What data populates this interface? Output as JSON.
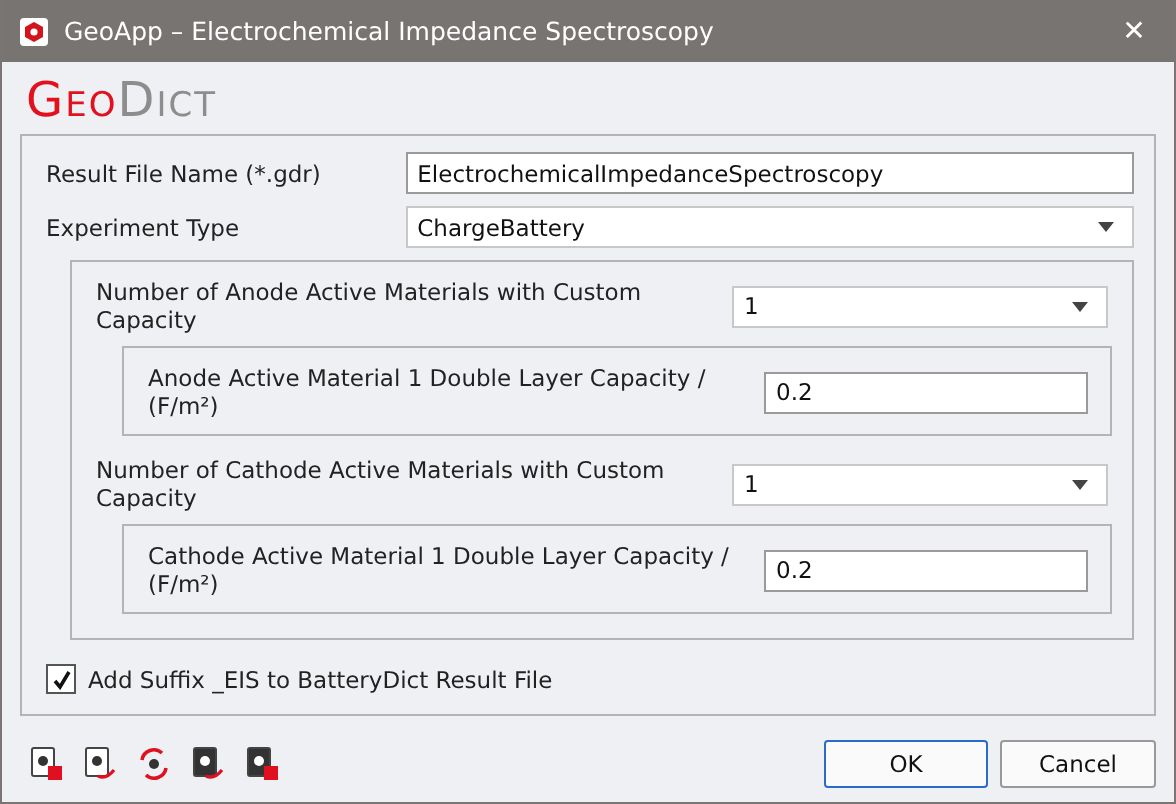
{
  "window": {
    "title": "GeoApp – Electrochemical Impedance Spectroscopy",
    "close": "✕"
  },
  "logo": [
    "Geo",
    "Dict"
  ],
  "result_file": {
    "label": "Result File Name (*.gdr)",
    "value": "ElectrochemicalImpedanceSpectroscopy"
  },
  "experiment_type": {
    "label": "Experiment Type",
    "value": "ChargeBattery"
  },
  "sections": [
    {
      "label": "Number of Anode Active Materials with Custom Capacity",
      "value": "1",
      "capacity": {
        "label": "Anode Active Material 1 Double Layer Capacity / (F/m²)",
        "value": "0.2"
      }
    },
    {
      "label": "Number of Cathode Active Materials with Custom Capacity",
      "value": "1",
      "capacity": {
        "label": "Cathode Active Material 1 Double Layer Capacity / (F/m²)",
        "value": "0.2"
      }
    }
  ],
  "suffix_option": {
    "label": "Add Suffix _EIS to BatteryDict Result File",
    "checked": true
  },
  "toolbar": [
    {
      "kind": "load"
    },
    {
      "kind": "save"
    },
    {
      "kind": "reset"
    },
    {
      "kind": "dark-save"
    },
    {
      "kind": "dark-load"
    }
  ],
  "buttons": [
    "OK",
    "Cancel"
  ]
}
